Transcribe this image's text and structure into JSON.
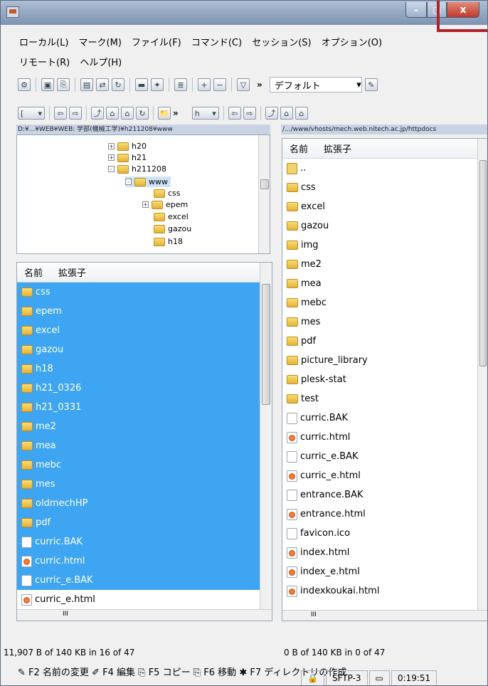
{
  "title_bar": {
    "min": "–",
    "max": "□",
    "close": "x"
  },
  "menu": {
    "row1": [
      "ローカル(L)",
      "マーク(M)",
      "ファイル(F)",
      "コマンド(C)",
      "セッション(S)",
      "オプション(O)"
    ],
    "row2": [
      "リモート(R)",
      "ヘルプ(H)"
    ]
  },
  "toolbar": {
    "preset": "デフォルト",
    "overflow": "»"
  },
  "local_path": "D:¥...¥WEB¥WEB: 学部(機械工学)¥h211208¥www",
  "remote_path": "/.../www/vhosts/mech.web.nitech.ac.jp/httpdocs",
  "local_drive": "[",
  "remote_drive": "h",
  "tree": [
    {
      "label": "h20",
      "sign": "+"
    },
    {
      "label": "h21",
      "sign": "+"
    },
    {
      "label": "h211208",
      "sign": "-"
    },
    {
      "label": "www",
      "sign": "-"
    },
    {
      "label": "css",
      "sign": ""
    },
    {
      "label": "epem",
      "sign": "+"
    },
    {
      "label": "excel",
      "sign": ""
    },
    {
      "label": "gazou",
      "sign": ""
    },
    {
      "label": "h18",
      "sign": ""
    }
  ],
  "local_headers": {
    "name": "名前",
    "ext": "拡張子"
  },
  "remote_headers": {
    "name": "名前",
    "ext": "拡張子"
  },
  "local_files": [
    {
      "name": "css",
      "type": "folder",
      "sel": true
    },
    {
      "name": "epem",
      "type": "folder",
      "sel": true
    },
    {
      "name": "excel",
      "type": "folder",
      "sel": true
    },
    {
      "name": "gazou",
      "type": "folder",
      "sel": true
    },
    {
      "name": "h18",
      "type": "folder",
      "sel": true
    },
    {
      "name": "h21_0326",
      "type": "folder",
      "sel": true
    },
    {
      "name": "h21_0331",
      "type": "folder",
      "sel": true
    },
    {
      "name": "me2",
      "type": "folder",
      "sel": true
    },
    {
      "name": "mea",
      "type": "folder",
      "sel": true
    },
    {
      "name": "mebc",
      "type": "folder",
      "sel": true
    },
    {
      "name": "mes",
      "type": "folder",
      "sel": true
    },
    {
      "name": "oldmechHP",
      "type": "folder",
      "sel": true
    },
    {
      "name": "pdf",
      "type": "folder",
      "sel": true
    },
    {
      "name": "curric.BAK",
      "type": "doc",
      "sel": true
    },
    {
      "name": "curric.html",
      "type": "html",
      "sel": true
    },
    {
      "name": "curric_e.BAK",
      "type": "doc",
      "sel": true
    },
    {
      "name": "curric_e.html",
      "type": "html",
      "sel": false
    }
  ],
  "remote_files": [
    {
      "name": "..",
      "type": "up"
    },
    {
      "name": "css",
      "type": "folder"
    },
    {
      "name": "excel",
      "type": "folder"
    },
    {
      "name": "gazou",
      "type": "folder"
    },
    {
      "name": "img",
      "type": "folder"
    },
    {
      "name": "me2",
      "type": "folder"
    },
    {
      "name": "mea",
      "type": "folder"
    },
    {
      "name": "mebc",
      "type": "folder"
    },
    {
      "name": "mes",
      "type": "folder"
    },
    {
      "name": "pdf",
      "type": "folder"
    },
    {
      "name": "picture_library",
      "type": "folder"
    },
    {
      "name": "plesk-stat",
      "type": "folder"
    },
    {
      "name": "test",
      "type": "folder"
    },
    {
      "name": "curric.BAK",
      "type": "doc"
    },
    {
      "name": "curric.html",
      "type": "html"
    },
    {
      "name": "curric_e.BAK",
      "type": "doc"
    },
    {
      "name": "curric_e.html",
      "type": "html"
    },
    {
      "name": "entrance.BAK",
      "type": "doc"
    },
    {
      "name": "entrance.html",
      "type": "html"
    },
    {
      "name": "favicon.ico",
      "type": "doc"
    },
    {
      "name": "index.html",
      "type": "html"
    },
    {
      "name": "index_e.html",
      "type": "html"
    },
    {
      "name": "indexkoukai.html",
      "type": "html"
    }
  ],
  "status_local": "11,907 B of 140 KB in 16 of 47",
  "status_remote": "0 B of 140 KB in 0 of 47",
  "fkeys": [
    "F2 名前の変更",
    "F4 編集",
    "F5 コピー",
    "F6 移動",
    "F7 ディレクトリの作成"
  ],
  "status_protocol": "SFTP-3",
  "status_time": "0:19:51",
  "scroll_glyph": "III"
}
